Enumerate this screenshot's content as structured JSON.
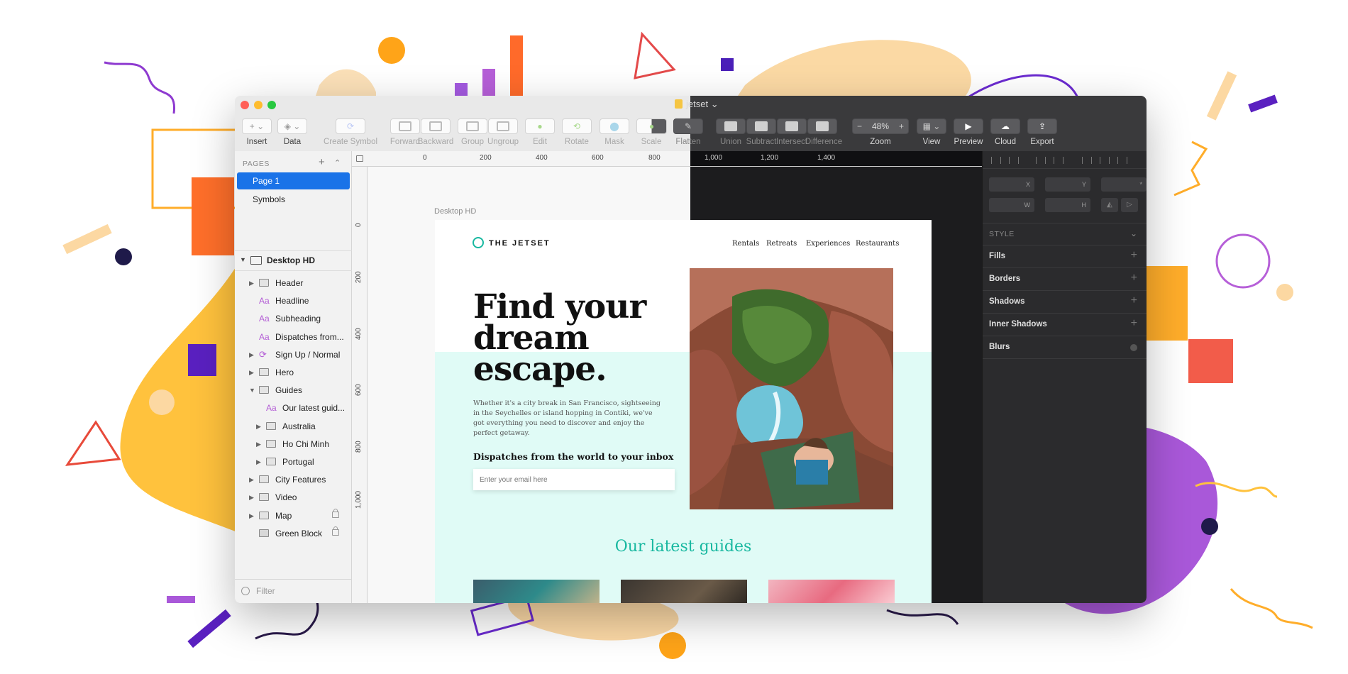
{
  "window": {
    "title": "jetset",
    "title_caret": "⌄"
  },
  "toolbar": {
    "items": [
      {
        "label": "Insert",
        "icon": "plus-icon"
      },
      {
        "label": "Data",
        "icon": "data-icon"
      },
      {
        "label": "Create Symbol",
        "icon": "symbol-icon"
      },
      {
        "label": "Forward",
        "icon": "forward-icon"
      },
      {
        "label": "Backward",
        "icon": "backward-icon"
      },
      {
        "label": "Group",
        "icon": "group-icon"
      },
      {
        "label": "Ungroup",
        "icon": "ungroup-icon"
      },
      {
        "label": "Edit",
        "icon": "edit-icon"
      },
      {
        "label": "Rotate",
        "icon": "rotate-icon"
      },
      {
        "label": "Mask",
        "icon": "mask-icon"
      },
      {
        "label": "Scale",
        "icon": "scale-icon"
      },
      {
        "label": "Flatten",
        "icon": "flatten-icon"
      },
      {
        "label": "Union",
        "icon": "union-icon"
      },
      {
        "label": "Subtract",
        "icon": "subtract-icon"
      },
      {
        "label": "Intersect",
        "icon": "intersect-icon"
      },
      {
        "label": "Difference",
        "icon": "difference-icon"
      },
      {
        "label": "Zoom",
        "icon": "zoom-icon"
      },
      {
        "label": "View",
        "icon": "view-icon"
      },
      {
        "label": "Preview",
        "icon": "play-icon"
      },
      {
        "label": "Cloud",
        "icon": "cloud-icon"
      },
      {
        "label": "Export",
        "icon": "export-icon"
      }
    ],
    "zoom_value": "48%",
    "zoom_minus": "−",
    "zoom_plus": "+"
  },
  "pages_panel": {
    "header": "PAGES",
    "add": "+",
    "collapse": "⌃",
    "pages": [
      "Page 1",
      "Symbols"
    ]
  },
  "layers_panel": {
    "artboard": "Desktop HD",
    "layers": [
      {
        "name": "Header",
        "kind": "group"
      },
      {
        "name": "Headline",
        "kind": "text"
      },
      {
        "name": "Subheading",
        "kind": "text"
      },
      {
        "name": "Dispatches from...",
        "kind": "text"
      },
      {
        "name": "Sign Up / Normal",
        "kind": "symbol"
      },
      {
        "name": "Hero",
        "kind": "group"
      },
      {
        "name": "Guides",
        "kind": "group-open"
      },
      {
        "name": "Our latest guid...",
        "kind": "text-nested"
      },
      {
        "name": "Australia",
        "kind": "group-nested"
      },
      {
        "name": "Ho Chi Minh",
        "kind": "group-nested"
      },
      {
        "name": "Portugal",
        "kind": "group-nested"
      },
      {
        "name": "City Features",
        "kind": "group"
      },
      {
        "name": "Video",
        "kind": "group"
      },
      {
        "name": "Map",
        "kind": "group-locked"
      },
      {
        "name": "Green Block",
        "kind": "shape-locked"
      }
    ],
    "text_glyph": "Aa",
    "filter_placeholder": "Filter"
  },
  "ruler": {
    "h_ticks": [
      "0",
      "200",
      "400",
      "600",
      "800",
      "1,000",
      "1,200",
      "1,400"
    ],
    "v_ticks": [
      "0",
      "200",
      "400",
      "600",
      "800",
      "1,000"
    ]
  },
  "artboard": {
    "label": "Desktop HD",
    "brand": "THE JETSET",
    "nav": [
      "Rentals",
      "Retreats",
      "Experiences",
      "Restaurants"
    ],
    "headline": "Find your dream escape.",
    "subheading": "Whether it's a city break in San Francisco, sightseeing in the Seychelles or island hopping in Contiki, we've got everything you need to discover and enjoy the perfect getaway.",
    "dispatches": "Dispatches from the world to your inbox",
    "email_placeholder": "Enter your email here",
    "guides_title": "Our latest guides"
  },
  "inspector": {
    "fields": [
      "X",
      "Y",
      "*",
      "W",
      "H"
    ],
    "style_header": "STYLE",
    "sections": [
      "Fills",
      "Borders",
      "Shadows",
      "Inner Shadows",
      "Blurs"
    ]
  },
  "colors": {
    "accent_blue": "#1a73e8",
    "teal": "#18b8a0",
    "mint": "#e0fbf6",
    "dark_ui": "#2b2b2d"
  }
}
